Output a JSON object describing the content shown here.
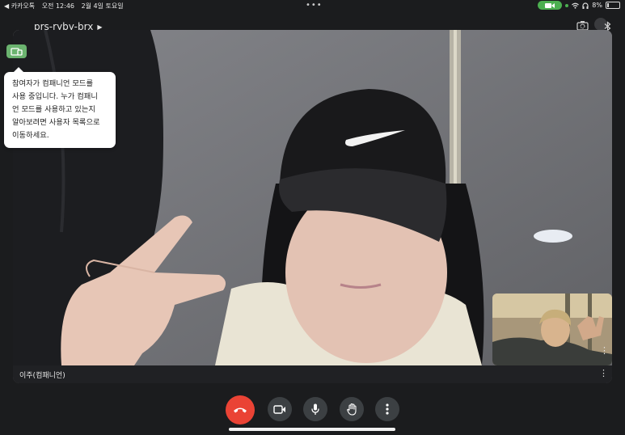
{
  "status_bar": {
    "back_app": "◀ 카카오톡",
    "time": "오전 12:46",
    "date": "2월 4일 토요일",
    "battery": "8%"
  },
  "header": {
    "meeting_code": "prs-ryby-brx"
  },
  "tooltip": {
    "lines": [
      "참여자가 컴패니언 모드를",
      "사용 중입니다. 누가 컴패니",
      "언 모드를 사용하고 있는지",
      "알아보려면 사용자 목록으로",
      "이동하세요."
    ]
  },
  "main_tile": {
    "participant_name": "이주(컴패니언)"
  },
  "colors": {
    "accent_green": "#6bb36f",
    "end_call_red": "#ea4335",
    "control_bg": "#3c4043"
  },
  "icons": {
    "companion": "companion-mode-icon",
    "switch_camera": "switch-camera-icon",
    "bluetooth": "bluetooth-icon",
    "end_call": "end-call-icon",
    "camera": "camera-icon",
    "mic": "mic-icon",
    "raise_hand": "raise-hand-icon",
    "more": "more-options-icon"
  }
}
